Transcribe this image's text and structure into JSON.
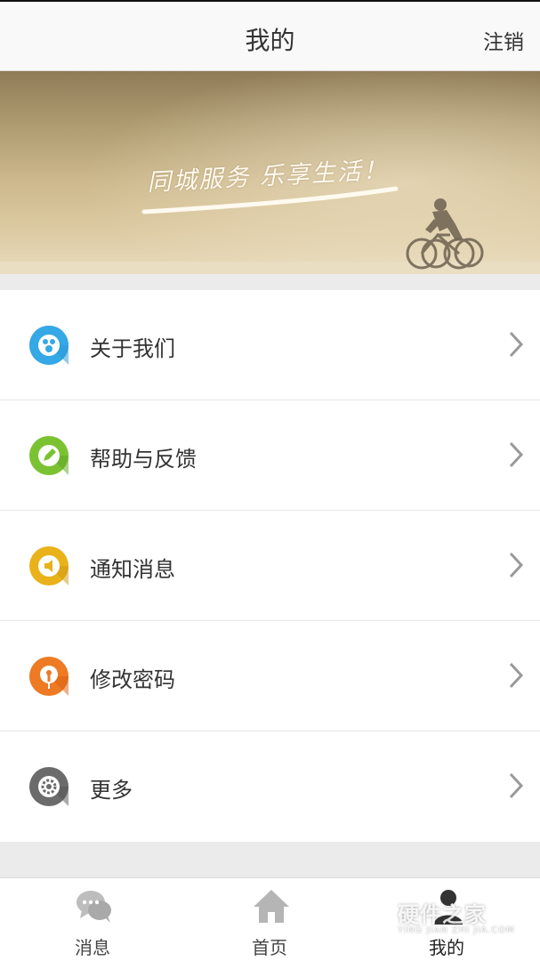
{
  "header": {
    "title": "我的",
    "logout_label": "注销"
  },
  "banner": {
    "slogan": "同城服务 乐享生活！"
  },
  "menu": [
    {
      "label": "关于我们",
      "icon": "paw-icon",
      "color": "#35a8e6"
    },
    {
      "label": "帮助与反馈",
      "icon": "pencil-icon",
      "color": "#7bc232"
    },
    {
      "label": "通知消息",
      "icon": "speaker-icon",
      "color": "#e9b21b"
    },
    {
      "label": "修改密码",
      "icon": "key-icon",
      "color": "#ee7a23"
    },
    {
      "label": "更多",
      "icon": "gear-icon",
      "color": "#6b6b6b"
    }
  ],
  "tabbar": {
    "tabs": [
      {
        "label": "消息",
        "icon": "chat-bubbles-icon"
      },
      {
        "label": "首页",
        "icon": "home-icon"
      },
      {
        "label": "我的",
        "icon": "person-icon",
        "active": true
      }
    ]
  },
  "watermark": {
    "text": "硬件之家",
    "sub": "YING JIAN ZHI JIA.COM"
  }
}
